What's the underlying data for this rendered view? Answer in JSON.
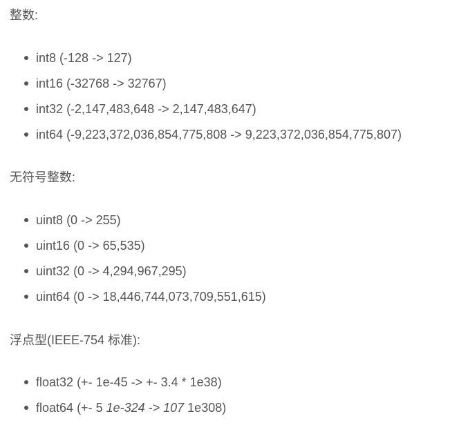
{
  "sections": [
    {
      "heading": "整数:",
      "items": [
        {
          "type": "int8",
          "range": "(-128 -> 127)"
        },
        {
          "type": "int16",
          "range": "(-32768 -> 32767)"
        },
        {
          "type": "int32",
          "range": "(-2,147,483,648 -> 2,147,483,647)"
        },
        {
          "type": "int64",
          "range": "(-9,223,372,036,854,775,808 -> 9,223,372,036,854,775,807)"
        }
      ]
    },
    {
      "heading": "无符号整数:",
      "items": [
        {
          "type": "uint8",
          "range": "(0 -> 255)"
        },
        {
          "type": "uint16",
          "range": "(0 -> 65,535)"
        },
        {
          "type": "uint32",
          "range": "(0 -> 4,294,967,295)"
        },
        {
          "type": "uint64",
          "range": "(0 -> 18,446,744,073,709,551,615)"
        }
      ]
    },
    {
      "heading": "浮点型(IEEE-754 标准):",
      "items": [
        {
          "type": "float32",
          "range": "(+- 1e-45 -> +- 3.4 * 1e38)"
        },
        {
          "type": "float64",
          "range_pre": "(+- 5 ",
          "range_em": "1e-324 -> 107",
          "range_post": " 1e308)"
        }
      ]
    }
  ]
}
